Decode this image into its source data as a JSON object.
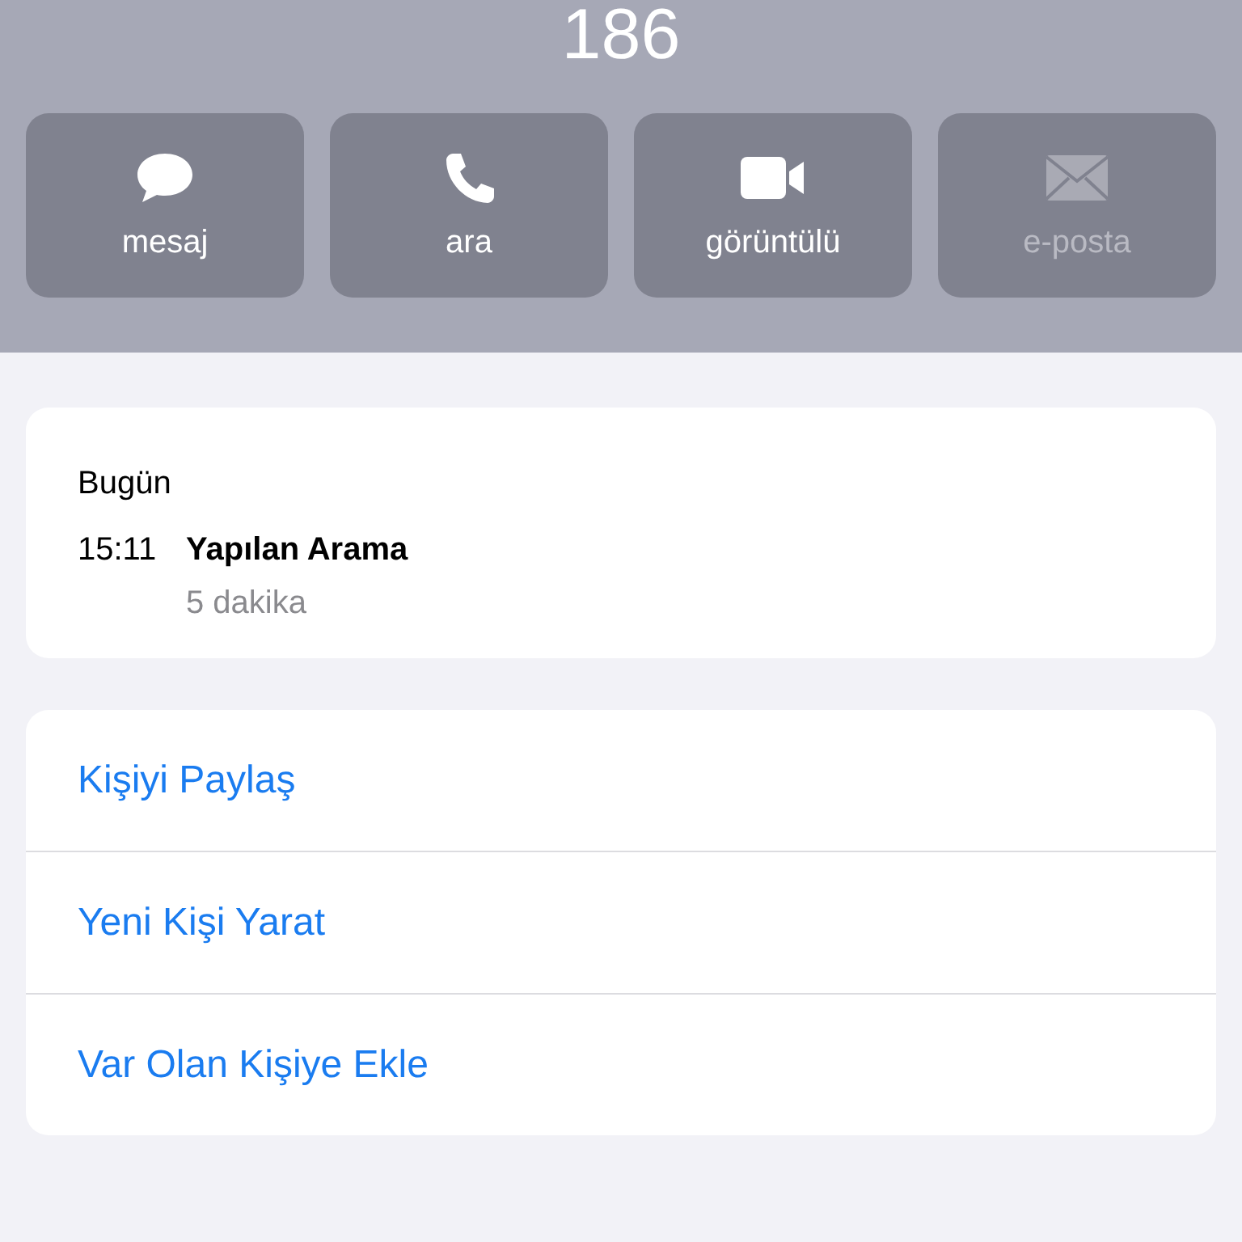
{
  "header": {
    "number": "186"
  },
  "actions": [
    {
      "kind": "message",
      "label": "mesaj",
      "disabled": false
    },
    {
      "kind": "call",
      "label": "ara",
      "disabled": false
    },
    {
      "kind": "video",
      "label": "görüntülü",
      "disabled": false
    },
    {
      "kind": "mail",
      "label": "e-posta",
      "disabled": true
    }
  ],
  "recents": {
    "day": "Bugün",
    "entries": [
      {
        "time": "15:11",
        "type": "Yapılan Arama",
        "duration": "5 dakika"
      }
    ]
  },
  "links": [
    "Kişiyi Paylaş",
    "Yeni Kişi Yarat",
    "Var Olan Kişiye Ekle"
  ]
}
